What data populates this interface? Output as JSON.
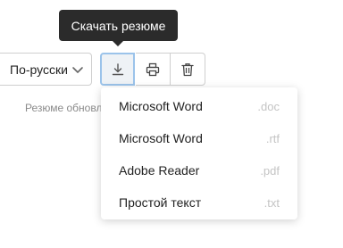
{
  "tooltip": {
    "text": "Скачать резюме"
  },
  "language_select": {
    "selected": "По-русски"
  },
  "toolbar": {
    "download_icon": "download-icon",
    "print_icon": "printer-icon",
    "delete_icon": "trash-icon",
    "accent_color": "#9bc3ea"
  },
  "status": {
    "text": "Резюме обновл"
  },
  "download_menu": {
    "items": [
      {
        "label": "Microsoft Word",
        "ext": ".doc"
      },
      {
        "label": "Microsoft Word",
        "ext": ".rtf"
      },
      {
        "label": "Adobe Reader",
        "ext": ".pdf"
      },
      {
        "label": "Простой текст",
        "ext": ".txt"
      }
    ]
  }
}
